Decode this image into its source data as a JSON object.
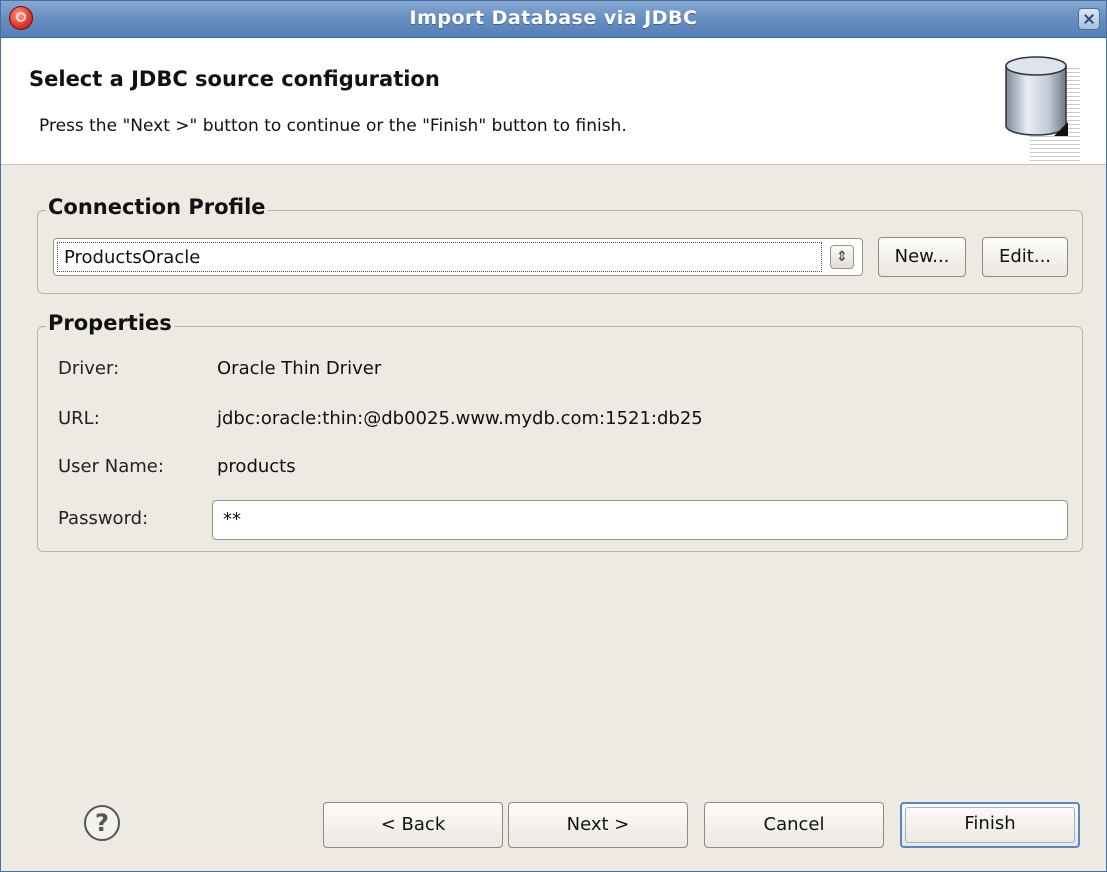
{
  "window": {
    "title": "Import Database via JDBC",
    "app_icon": "app-icon",
    "close_icon": "close-icon"
  },
  "header": {
    "title": "Select a JDBC source configuration",
    "description": "Press the \"Next >\" button to continue or the \"Finish\" button to finish.",
    "banner_icon": "database-icon"
  },
  "connection_profile": {
    "legend": "Connection Profile",
    "selected": "ProductsOracle",
    "new_label": "New...",
    "edit_label": "Edit..."
  },
  "properties": {
    "legend": "Properties",
    "driver_label": "Driver:",
    "driver_value": "Oracle Thin Driver",
    "url_label": "URL:",
    "url_value": "jdbc:oracle:thin:@db0025.www.mydb.com:1521:db25",
    "user_label": "User Name:",
    "user_value": "products",
    "password_label": "Password:",
    "password_value": "**"
  },
  "footer": {
    "help_icon": "help-icon",
    "back_label": "< Back",
    "next_label": "Next >",
    "cancel_label": "Cancel",
    "finish_label": "Finish"
  }
}
